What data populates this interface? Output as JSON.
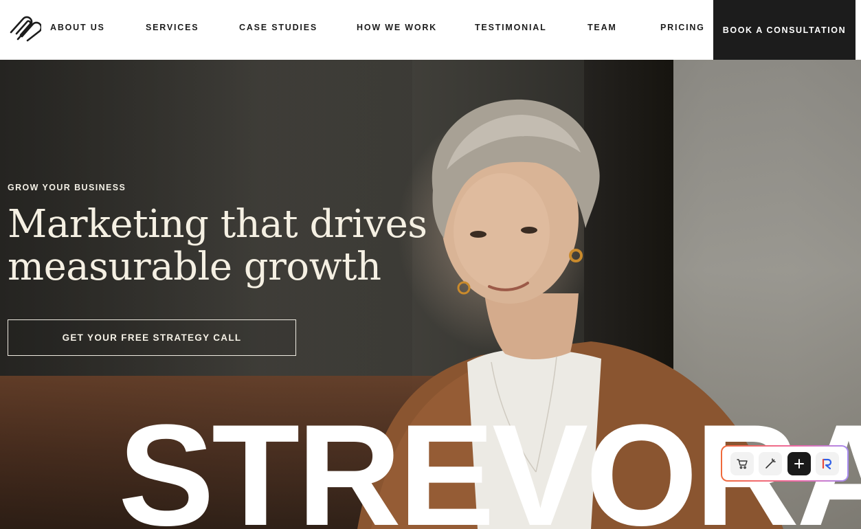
{
  "header": {
    "logo_name": "paperclip-logo",
    "nav": [
      {
        "label": "ABOUT US"
      },
      {
        "label": "SERVICES"
      },
      {
        "label": "CASE STUDIES"
      },
      {
        "label": "HOW WE WORK"
      },
      {
        "label": "TESTIMONIAL"
      },
      {
        "label": "TEAM"
      },
      {
        "label": "PRICING"
      }
    ],
    "cta_label": "BOOK A CONSULTATION"
  },
  "hero": {
    "eyebrow": "GROW YOUR BUSINESS",
    "headline_line1": "Marketing that drives",
    "headline_line2": "measurable growth",
    "cta_label": "GET YOUR FREE STRATEGY CALL",
    "brand_wordmark": "STREVORA"
  },
  "toolbar": {
    "items": [
      {
        "icon": "cart-icon"
      },
      {
        "icon": "magic-wand-icon"
      },
      {
        "icon": "plus-icon"
      },
      {
        "icon": "r-logo-icon"
      }
    ]
  },
  "colors": {
    "header_bg": "#ffffff",
    "nav_text": "#1c1c1c",
    "cta_bg": "#1c1c1c",
    "hero_text": "#f5f0e3",
    "toolbar_gradient_start": "#f06a3a",
    "toolbar_gradient_end": "#a68cf0"
  }
}
